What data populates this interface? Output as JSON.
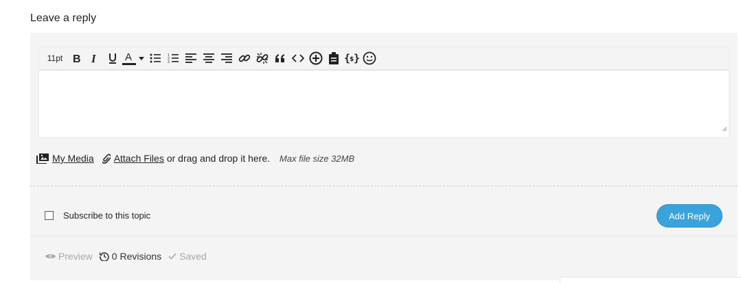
{
  "heading": "Leave a reply",
  "toolbar": {
    "font_size": "11pt",
    "buttons": [
      "bold-icon",
      "italic-icon",
      "underline-icon",
      "text-color-icon",
      "dropdown-caret-icon",
      "bullet-list-icon",
      "numbered-list-icon",
      "align-left-icon",
      "align-center-icon",
      "align-right-icon",
      "link-icon",
      "unlink-icon",
      "blockquote-icon",
      "code-icon",
      "insert-plus-icon",
      "paste-icon",
      "code-braces-icon",
      "emoji-icon"
    ]
  },
  "attachments": {
    "my_media": "My Media",
    "attach_files": "Attach Files",
    "drag_text": "or drag and drop it here.",
    "max_size": "Max file size 32MB"
  },
  "subscribe": {
    "label": "Subscribe to this topic",
    "checked": false
  },
  "add_reply": "Add Reply",
  "footer": {
    "preview": "Preview",
    "revisions": "0 Revisions",
    "saved": "Saved"
  },
  "colors": {
    "accent": "#3aa3dc",
    "panel_bg": "#f4f4f4",
    "muted_text": "#a8a8a8"
  }
}
